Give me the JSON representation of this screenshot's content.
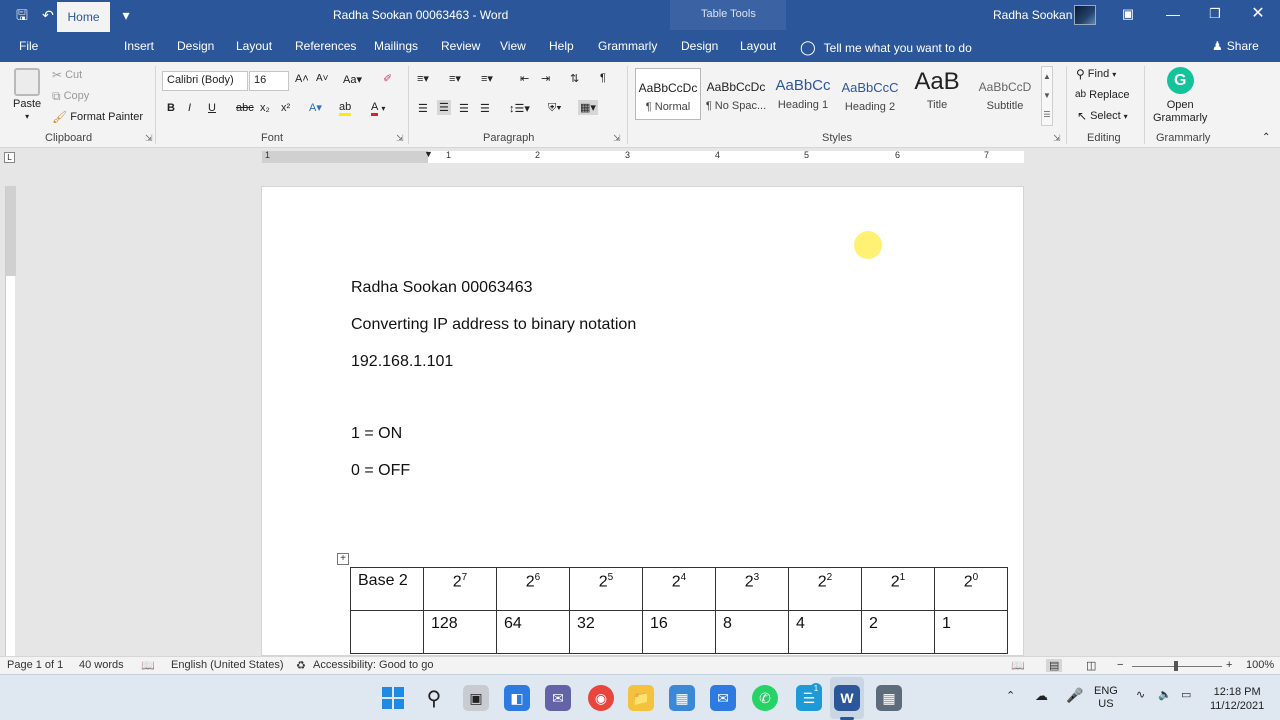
{
  "titlebar": {
    "doc_title": "Radha Sookan 00063463  -  Word",
    "context_group": "Table Tools",
    "user_name": "Radha Sookan"
  },
  "tabs": {
    "file": "File",
    "home": "Home",
    "insert": "Insert",
    "design": "Design",
    "layout": "Layout",
    "references": "References",
    "mailings": "Mailings",
    "review": "Review",
    "view": "View",
    "help": "Help",
    "grammarly": "Grammarly",
    "table_design": "Design",
    "table_layout": "Layout",
    "tell_me": "Tell me what you want to do",
    "share": "Share"
  },
  "clipboard": {
    "paste": "Paste",
    "cut": "Cut",
    "copy": "Copy",
    "format_painter": "Format Painter",
    "label": "Clipboard"
  },
  "font": {
    "family": "Calibri (Body)",
    "size": "16",
    "label": "Font"
  },
  "paragraph": {
    "label": "Paragraph"
  },
  "styles": {
    "label": "Styles",
    "items": [
      {
        "preview": "AaBbCcDc",
        "name": "¶ Normal"
      },
      {
        "preview": "AaBbCcDc",
        "name": "¶ No Spac..."
      },
      {
        "preview": "AaBbCc",
        "name": "Heading 1"
      },
      {
        "preview": "AaBbCcC",
        "name": "Heading 2"
      },
      {
        "preview": "AaB",
        "name": "Title"
      },
      {
        "preview": "AaBbCcD",
        "name": "Subtitle"
      }
    ]
  },
  "editing": {
    "find": "Find",
    "replace": "Replace",
    "select": "Select",
    "label": "Editing"
  },
  "grammarly_group": {
    "open_line1": "Open",
    "open_line2": "Grammarly",
    "label": "Grammarly"
  },
  "ruler": {
    "numbers": [
      "1",
      "1",
      "2",
      "3",
      "4",
      "5",
      "6",
      "7"
    ]
  },
  "document": {
    "line1": "Radha Sookan 00063463",
    "line2": "Converting IP address to binary notation",
    "line3": "192.168.1.101",
    "line4": "1 = ON",
    "line5": "0 = OFF"
  },
  "table": {
    "row1_label": "Base 2",
    "exponents": [
      "7",
      "6",
      "5",
      "4",
      "3",
      "2",
      "1",
      "0"
    ],
    "base": "2",
    "row2_label": "",
    "values": [
      "128",
      "64",
      "32",
      "16",
      "8",
      "4",
      "2",
      "1"
    ]
  },
  "statusbar": {
    "page": "Page 1 of 1",
    "words": "40 words",
    "language": "English (United States)",
    "accessibility": "Accessibility: Good to go",
    "zoom": "100%"
  },
  "taskbar": {
    "lang_line1": "ENG",
    "lang_line2": "US",
    "time": "12:18 PM",
    "date": "11/12/2021",
    "badge": "1"
  }
}
